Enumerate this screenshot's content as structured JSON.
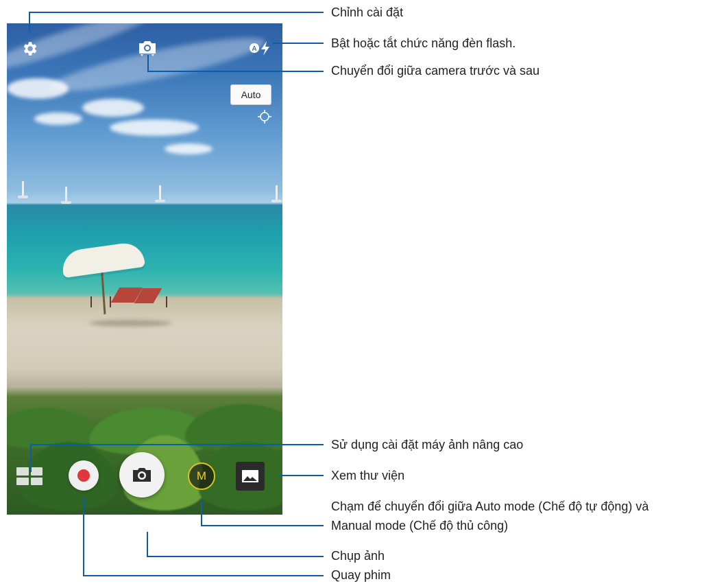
{
  "camera": {
    "auto_badge": "Auto",
    "mode_label": "M",
    "icons": {
      "settings": "gear-icon",
      "switch_camera": "switch-camera-icon",
      "flash": "flash-auto-icon",
      "focus": "focus-target-icon",
      "shutter": "camera-icon",
      "record": "record-icon",
      "gallery": "gallery-icon",
      "advanced": "grid-icon"
    },
    "colors": {
      "annotation_line": "#0b5da8",
      "record_red": "#e0363c",
      "mode_yellow": "#f0d11d"
    }
  },
  "annotations": {
    "settings": "Chỉnh cài đặt",
    "flash": "Bật hoặc tắt chức năng đèn flash.",
    "switch_camera": "Chuyển đổi giữa camera trước và sau",
    "advanced": "Sử dụng cài đặt máy ảnh nâng cao",
    "gallery": "Xem thư viện",
    "mode_line1": "Chạm để chuyển đổi giữa Auto mode (Chế độ tự động) và",
    "mode_line2": "Manual mode (Chế độ thủ công)",
    "shutter": "Chụp ảnh",
    "record": "Quay phim"
  }
}
